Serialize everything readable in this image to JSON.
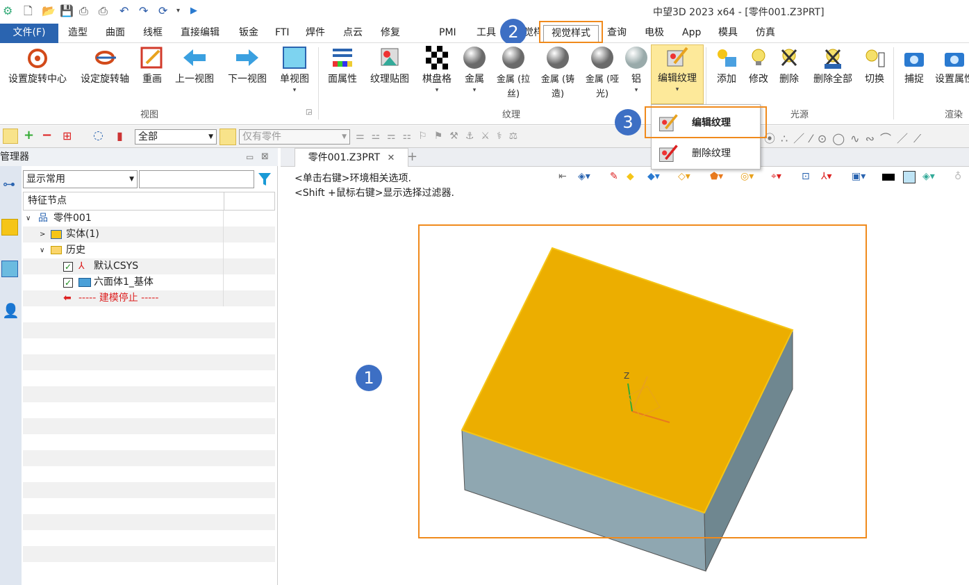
{
  "window": {
    "title": "中望3D 2023 x64 - [零件001.Z3PRT]"
  },
  "menu": {
    "file": "文件(F)",
    "items": [
      "造型",
      "曲面",
      "线框",
      "直接编辑",
      "钣金",
      "FTI",
      "焊件",
      "点云",
      "修复",
      "PMI",
      "工具",
      "视觉样式",
      "查询",
      "电极",
      "App",
      "模具",
      "仿真"
    ],
    "active": "视觉样式"
  },
  "ribbon": {
    "view_group": {
      "label": "视图",
      "buttons": [
        "设置旋转中心",
        "设定旋转轴",
        "重画",
        "上一视图",
        "下一视图",
        "单视图"
      ]
    },
    "texture_group": {
      "label": "纹理",
      "buttons": [
        "面属性",
        "纹理贴图",
        "棋盘格",
        "金属",
        "金属 (拉丝)",
        "金属 (铸造)",
        "金属 (哑光)",
        "铝",
        "编辑纹理"
      ]
    },
    "light_group": {
      "label": "光源",
      "buttons": [
        "添加",
        "修改",
        "删除",
        "删除全部",
        "切换"
      ]
    },
    "render_group": {
      "label": "渲染",
      "buttons": [
        "捕捉",
        "设置属性"
      ]
    }
  },
  "toolbar": {
    "filter_value": "全部",
    "select_placeholder": "仅有零件"
  },
  "panel": {
    "title": "管理器",
    "display_combo": "显示常用",
    "column_header": "特征节点",
    "tree": [
      {
        "label": "零件001",
        "level": 0
      },
      {
        "label": "实体(1)",
        "level": 1
      },
      {
        "label": "历史",
        "level": 1
      },
      {
        "label": "默认CSYS",
        "level": 2
      },
      {
        "label": "六面体1_基体",
        "level": 2
      },
      {
        "label": "----- 建模停止 -----",
        "level": 2
      }
    ]
  },
  "doc_tab": {
    "label": "零件001.Z3PRT"
  },
  "viewport": {
    "hint1": "<单击右键>环境相关选项.",
    "hint2": "<Shift +鼠标右键>显示选择过滤器."
  },
  "dropdown": {
    "items": [
      "编辑纹理",
      "删除纹理"
    ]
  },
  "callouts": [
    "1",
    "2",
    "3"
  ],
  "colors": {
    "accent": "#2a64b0",
    "highlight": "#f08a1c",
    "top_face": "#ecae00",
    "side_face": "#8fa5af",
    "badge": "#3d6fc4"
  }
}
